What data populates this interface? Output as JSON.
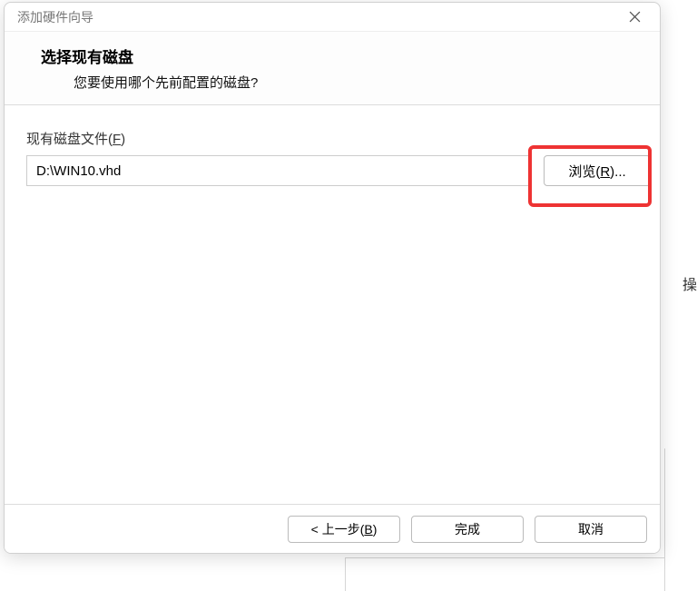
{
  "window": {
    "title": "添加硬件向导",
    "close_label": "关闭"
  },
  "header": {
    "title": "选择现有磁盘",
    "subtitle": "您要使用哪个先前配置的磁盘?"
  },
  "body": {
    "file_label_prefix": "现有磁盘文件(",
    "file_label_mnemonic": "F",
    "file_label_suffix": ")",
    "file_value": "D:\\WIN10.vhd",
    "browse_prefix": "浏览(",
    "browse_mnemonic": "R",
    "browse_suffix": ")..."
  },
  "footer": {
    "back_prefix": "< 上一步(",
    "back_mnemonic": "B",
    "back_suffix": ")",
    "finish": "完成",
    "cancel": "取消"
  },
  "background": {
    "fragment": "操"
  }
}
